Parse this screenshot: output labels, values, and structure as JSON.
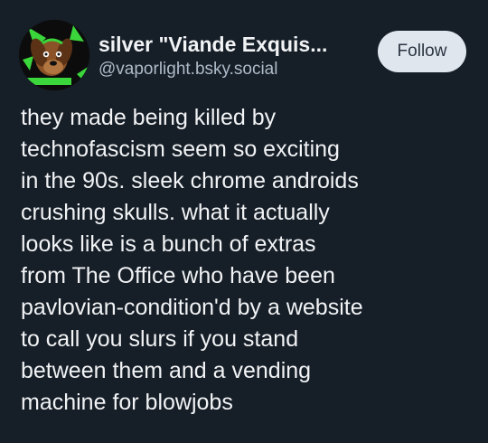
{
  "author": {
    "display_name": "silver \"Viande Exquis...",
    "handle": "@vaporlight.bsky.social",
    "avatar_icon": "cartoon-dog-avatar"
  },
  "follow_button": {
    "label": "Follow"
  },
  "post": {
    "lines": [
      "they made being killed by",
      "technofascism seem so exciting",
      "in the 90s. sleek chrome androids",
      "crushing skulls. what it actually",
      "looks like is a bunch of extras",
      "from The Office who have been",
      "pavlovian-condition'd by a website",
      "to call you slurs if you stand",
      "between them and a vending",
      "machine for blowjobs"
    ]
  },
  "colors": {
    "background": "#161e27",
    "text_primary": "#f1f3f5",
    "text_secondary": "#aebbc9",
    "button_bg": "#dfe6ee",
    "button_text": "#2a3440",
    "avatar_accent": "#3bd63b"
  }
}
